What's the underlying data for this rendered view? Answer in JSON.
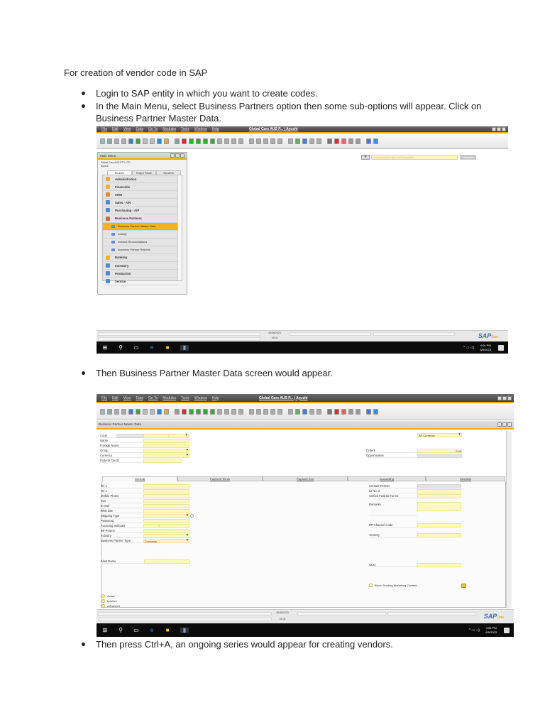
{
  "doc": {
    "heading": "For creation of vendor code in SAP",
    "bullets": [
      "Login to SAP entity in which you want to create codes.",
      "In the Main Menu, select Business Partners option then some sub-options will appear. Click on Business Partner Master Data.",
      "Then Business Partner Master Data screen would appear.",
      "Then press Ctrl+A, an ongoing series would appear for creating vendors."
    ]
  },
  "sap": {
    "menu": [
      "File",
      "Edit",
      "View",
      "Data",
      "Go To",
      "Modules",
      "Tools",
      "Window",
      "Help"
    ],
    "window_title": "Global Cars AUS P... | Ayushi",
    "toolbar_icons": [
      "preview-icon",
      "print-icon",
      "email-icon",
      "export-icon",
      "briefcase-icon",
      "excel-icon",
      "word-icon",
      "pdf-icon",
      "up-arrow-icon",
      "form-icon",
      "find-icon",
      "add-icon",
      "first-record-icon",
      "previous-record-icon",
      "next-record-icon",
      "last-record-icon",
      "refresh-icon",
      "filter-icon",
      "sort-icon",
      "copy-icon",
      "paste-icon",
      "save-icon",
      "stamp-icon",
      "grid-icon",
      "grid2-icon",
      "edit-icon",
      "new-doc-icon",
      "attach-icon",
      "message-icon",
      "chat-icon",
      "calendar-icon",
      "report-icon",
      "chart-icon",
      "user-icon",
      "users-icon",
      "window-icon",
      "help-icon"
    ],
    "status_date": "09/08/2023",
    "logo": "SAP Business One",
    "logo_main": "SAP",
    "logo_sub": "One"
  },
  "screen1": {
    "main_menu": {
      "title": "Main Menu",
      "company": "Global Cars AUS PTY LTD",
      "user": "Ayushi",
      "tabs": [
        "Modules",
        "Drag & Relate",
        "My Menu"
      ],
      "items": [
        {
          "label": "Administration",
          "sub": false,
          "color": "#e9a53a"
        },
        {
          "label": "Financials",
          "sub": false,
          "color": "#f0b030"
        },
        {
          "label": "CRM",
          "sub": false,
          "color": "#e38b2c"
        },
        {
          "label": "Sales - A/R",
          "sub": false,
          "color": "#4f8ad2"
        },
        {
          "label": "Purchasing - A/P",
          "sub": false,
          "color": "#4f8ad2"
        },
        {
          "label": "Business Partners",
          "sub": false,
          "color": "#c96a3a"
        },
        {
          "label": "Business Partner Master Data",
          "sub": true,
          "selected": true
        },
        {
          "label": "Activity",
          "sub": true
        },
        {
          "label": "Internal Reconciliations",
          "sub": true
        },
        {
          "label": "Business Partner Reports",
          "sub": true
        },
        {
          "label": "Banking",
          "sub": false,
          "color": "#f0b030"
        },
        {
          "label": "Inventory",
          "sub": false,
          "color": "#4f8ad2"
        },
        {
          "label": "Production",
          "sub": false,
          "color": "#4f8ad2"
        },
        {
          "label": "Service",
          "sub": false,
          "color": "#4f8ad2"
        }
      ]
    },
    "search_placeholder": "Look up master data and documents",
    "search_button": "Search",
    "status_time": "16:04",
    "clock_time": "4:04 PM",
    "clock_date": "8/9/2023"
  },
  "screen2": {
    "form_title": "Business Partner Master Data",
    "header_left": [
      {
        "label": "Code",
        "type": "code"
      },
      {
        "label": "Name",
        "type": "text"
      },
      {
        "label": "Foreign Name",
        "type": "text"
      },
      {
        "label": "Group",
        "type": "dd"
      },
      {
        "label": "Currency",
        "type": "dd"
      },
      {
        "label": "Federal Tax ID",
        "type": "short"
      }
    ],
    "bp_currency": "BP Currency",
    "header_right": [
      {
        "label": "Orders",
        "value": "0.00",
        "type": "text"
      },
      {
        "label": "Opportunities",
        "value": "",
        "type": "gray"
      }
    ],
    "tabs": [
      "General",
      "Payment Terms",
      "Payment Run",
      "Accounting",
      "Remarks"
    ],
    "general_left": [
      {
        "label": "Tel 1",
        "type": "text"
      },
      {
        "label": "Tel 2",
        "type": "text"
      },
      {
        "label": "Mobile Phone",
        "type": "text"
      },
      {
        "label": "Fax",
        "type": "text"
      },
      {
        "label": "E-Mail",
        "type": "text"
      },
      {
        "label": "Web Site",
        "type": "text"
      },
      {
        "label": "Shipping Type",
        "type": "dd"
      },
      {
        "label": "Password",
        "type": "text"
      },
      {
        "label": "Factoring Indicator",
        "type": "split"
      },
      {
        "label": "BP Project",
        "type": "text"
      },
      {
        "label": "Industry",
        "type": "dd"
      },
      {
        "label": "Business Partner Type",
        "type": "dd",
        "value": "Company"
      }
    ],
    "alias_name": "Alias Name",
    "general_right": {
      "contact_person": "Contact Person",
      "id_no_2": "ID No. 2",
      "unified_tax": "Unified Federal Tax ID",
      "remarks": "Remarks",
      "channel_code": "BP Channel Code",
      "territory": "Territory",
      "gln": "GLN",
      "block_marketing": "Block Sending Marketing Content"
    },
    "status_options": [
      "Active",
      "Inactive",
      "Advanced"
    ],
    "status_time": "16:05",
    "clock_time": "4:05 PM",
    "clock_date": "8/9/2023"
  }
}
